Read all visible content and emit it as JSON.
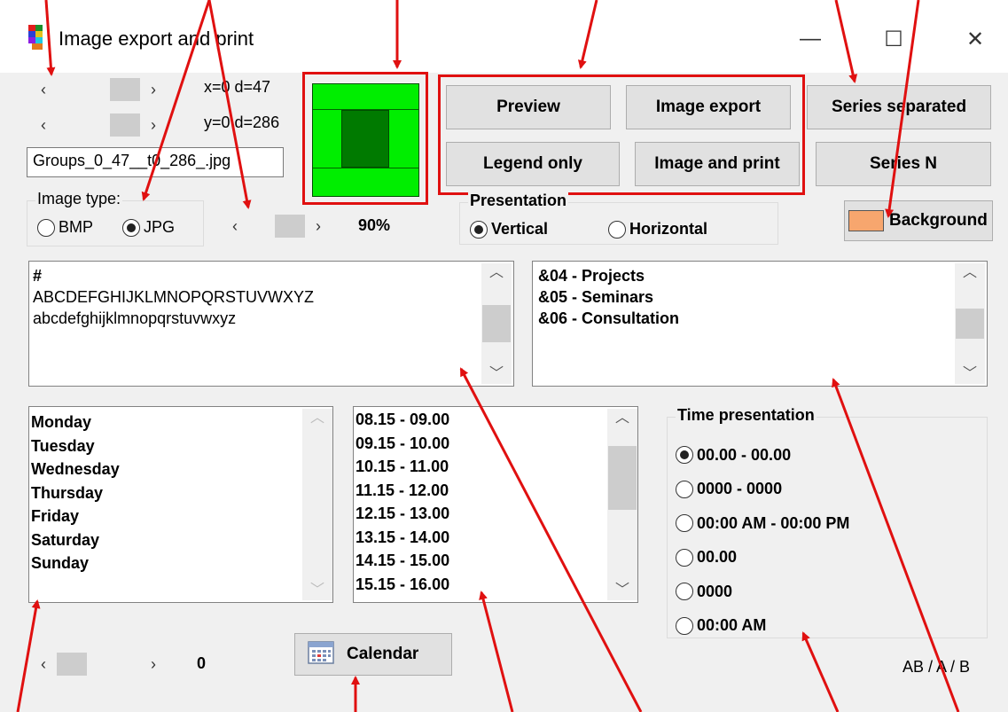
{
  "window": {
    "title": "Image export and print",
    "minimize_icon": "—",
    "maximize_icon": "☐",
    "close_icon": "✕"
  },
  "position": {
    "x_readout": "x=0 d=47",
    "y_readout": "y=0 d=286",
    "filename": "Groups_0_47__t0_286_.jpg"
  },
  "image_type": {
    "label": "Image type:",
    "options": [
      "BMP",
      "JPG"
    ],
    "selected": "JPG"
  },
  "zoom": {
    "value": "90%"
  },
  "buttons": {
    "preview": "Preview",
    "image_export": "Image export",
    "series_separated": "Series separated",
    "legend_only": "Legend only",
    "image_and_print": "Image and print",
    "series_n": "Series N",
    "background": "Background",
    "calendar": "Calendar"
  },
  "presentation": {
    "label": "Presentation",
    "options": [
      "Vertical",
      "Horizontal"
    ],
    "selected": "Vertical"
  },
  "font_sample": {
    "lines": [
      "#",
      "ABCDEFGHIJKLMNOPQRSTUVWXYZ",
      "abcdefghijklmnopqrstuvwxyz"
    ]
  },
  "categories": {
    "lines": [
      "&04 - Projects",
      "&05 - Seminars",
      "&06 - Consultation"
    ]
  },
  "days": [
    "Monday",
    "Tuesday",
    "Wednesday",
    "Thursday",
    "Friday",
    "Saturday",
    "Sunday"
  ],
  "times": [
    "08.15 - 09.00",
    "09.15 - 10.00",
    "10.15 - 11.00",
    "11.15 - 12.00",
    "12.15 - 13.00",
    "13.15 - 14.00",
    "14.15 - 15.00",
    "15.15 - 16.00"
  ],
  "time_presentation": {
    "label": "Time presentation",
    "options": [
      "00.00 - 00.00",
      "0000 - 0000",
      "00:00 AM - 00:00 PM",
      "00.00",
      "0000",
      "00:00 AM"
    ],
    "selected": "00.00 - 00.00"
  },
  "bottom_scroll": {
    "value": "0"
  },
  "footer": {
    "text": "AB / A / B"
  },
  "colors": {
    "preview_outer": "#00ee00",
    "preview_inner": "#007a00",
    "background_swatch": "#f7a66e",
    "annotation_red": "#e01010"
  }
}
